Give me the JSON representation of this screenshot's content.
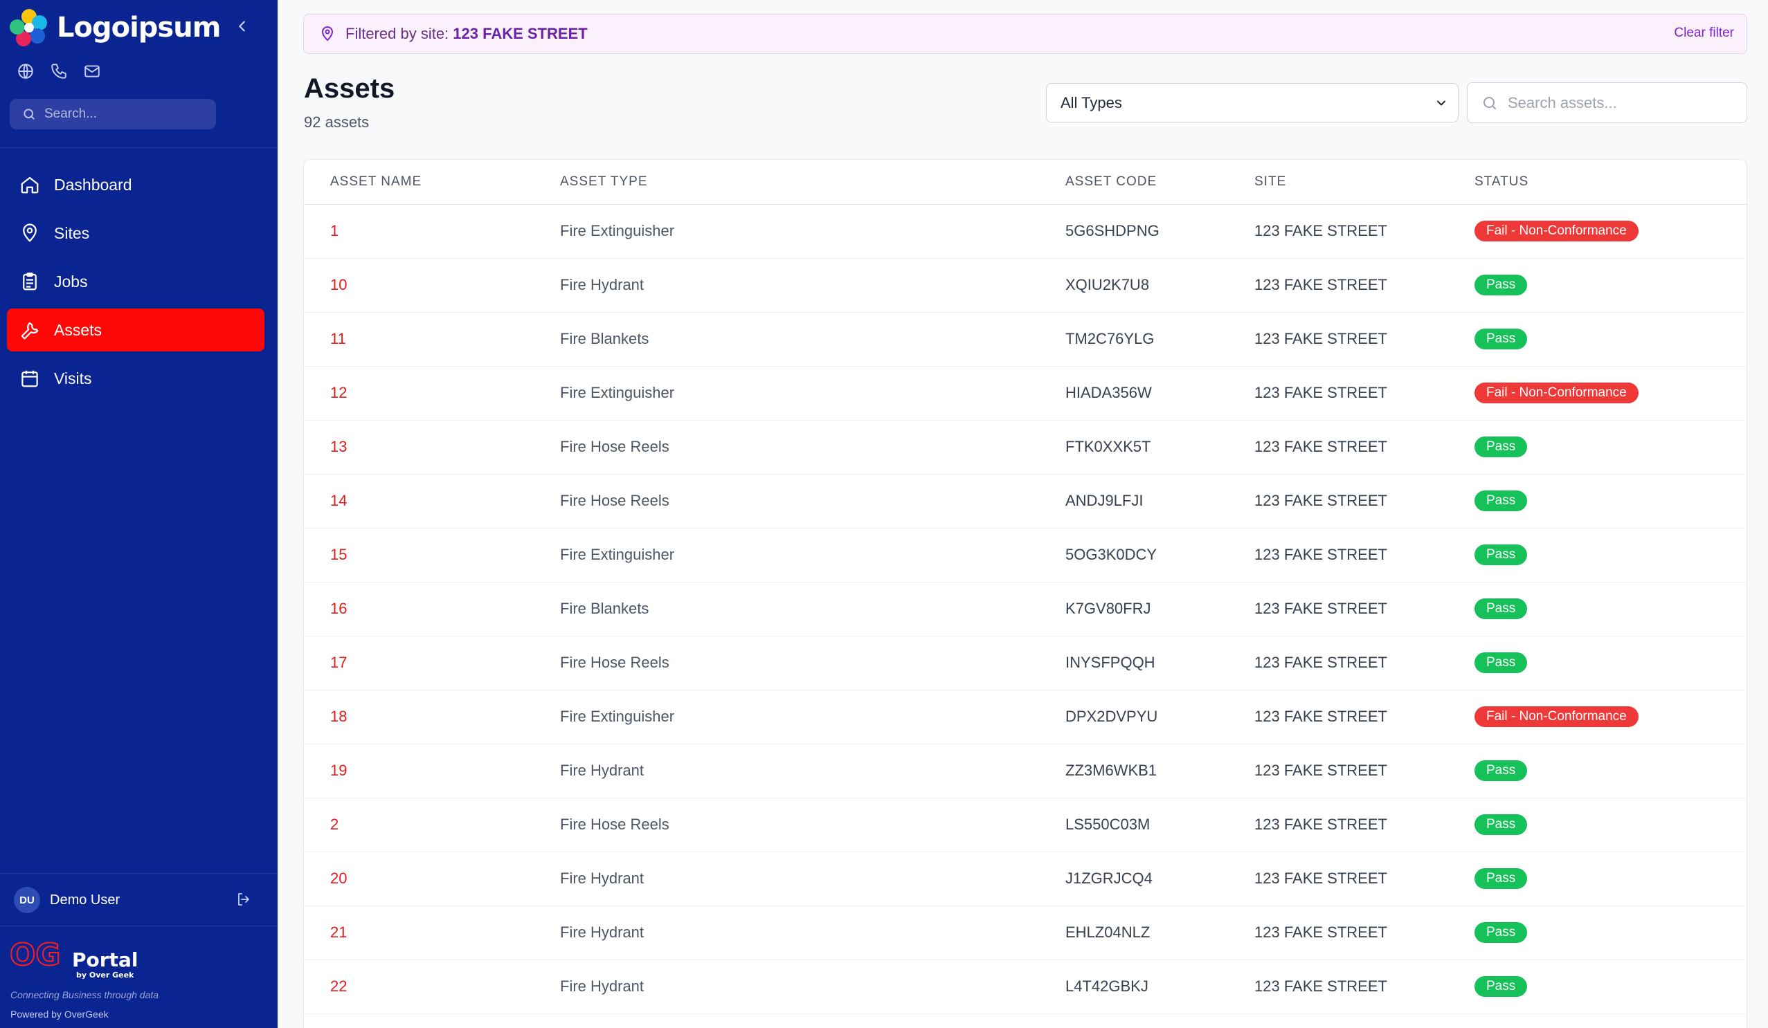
{
  "brand": {
    "name": "Logoipsum"
  },
  "sidebar": {
    "search_placeholder": "Search...",
    "nav": [
      {
        "label": "Dashboard",
        "icon": "home-icon",
        "active": false
      },
      {
        "label": "Sites",
        "icon": "map-pin-icon",
        "active": false
      },
      {
        "label": "Jobs",
        "icon": "clipboard-icon",
        "active": false
      },
      {
        "label": "Assets",
        "icon": "wrench-icon",
        "active": true
      },
      {
        "label": "Visits",
        "icon": "calendar-icon",
        "active": false
      }
    ],
    "user": {
      "initials": "DU",
      "name": "Demo User"
    },
    "footer": {
      "og_brand": "OG",
      "portal_label": "Portal",
      "by_label": "by Over Geek",
      "tagline": "Connecting Business through data",
      "powered_by": "Powered by OverGeek"
    },
    "colors": {
      "background": "#0a2492",
      "active": "#ff0707"
    }
  },
  "filter": {
    "prefix": "Filtered by site: ",
    "site": "123 FAKE STREET",
    "clear_label": "Clear filter"
  },
  "page": {
    "title": "Assets",
    "count_label": "92 assets"
  },
  "controls": {
    "type_select": {
      "selected": "All Types"
    },
    "search_placeholder": "Search assets..."
  },
  "table": {
    "columns": [
      "ASSET NAME",
      "ASSET TYPE",
      "ASSET CODE",
      "SITE",
      "STATUS"
    ],
    "rows": [
      {
        "name": "1",
        "type": "Fire Extinguisher",
        "code": "5G6SHDPNG",
        "site": "123 FAKE STREET",
        "status": "Fail - Non-Conformance"
      },
      {
        "name": "10",
        "type": "Fire Hydrant",
        "code": "XQIU2K7U8",
        "site": "123 FAKE STREET",
        "status": "Pass"
      },
      {
        "name": "11",
        "type": "Fire Blankets",
        "code": "TM2C76YLG",
        "site": "123 FAKE STREET",
        "status": "Pass"
      },
      {
        "name": "12",
        "type": "Fire Extinguisher",
        "code": "HIADA356W",
        "site": "123 FAKE STREET",
        "status": "Fail - Non-Conformance"
      },
      {
        "name": "13",
        "type": "Fire Hose Reels",
        "code": "FTK0XXK5T",
        "site": "123 FAKE STREET",
        "status": "Pass"
      },
      {
        "name": "14",
        "type": "Fire Hose Reels",
        "code": "ANDJ9LFJI",
        "site": "123 FAKE STREET",
        "status": "Pass"
      },
      {
        "name": "15",
        "type": "Fire Extinguisher",
        "code": "5OG3K0DCY",
        "site": "123 FAKE STREET",
        "status": "Pass"
      },
      {
        "name": "16",
        "type": "Fire Blankets",
        "code": "K7GV80FRJ",
        "site": "123 FAKE STREET",
        "status": "Pass"
      },
      {
        "name": "17",
        "type": "Fire Hose Reels",
        "code": "INYSFPQQH",
        "site": "123 FAKE STREET",
        "status": "Pass"
      },
      {
        "name": "18",
        "type": "Fire Extinguisher",
        "code": "DPX2DVPYU",
        "site": "123 FAKE STREET",
        "status": "Fail - Non-Conformance"
      },
      {
        "name": "19",
        "type": "Fire Hydrant",
        "code": "ZZ3M6WKB1",
        "site": "123 FAKE STREET",
        "status": "Pass"
      },
      {
        "name": "2",
        "type": "Fire Hose Reels",
        "code": "LS550C03M",
        "site": "123 FAKE STREET",
        "status": "Pass"
      },
      {
        "name": "20",
        "type": "Fire Hydrant",
        "code": "J1ZGRJCQ4",
        "site": "123 FAKE STREET",
        "status": "Pass"
      },
      {
        "name": "21",
        "type": "Fire Hydrant",
        "code": "EHLZ04NLZ",
        "site": "123 FAKE STREET",
        "status": "Pass"
      },
      {
        "name": "22",
        "type": "Fire Hydrant",
        "code": "L4T42GBKJ",
        "site": "123 FAKE STREET",
        "status": "Pass"
      }
    ]
  },
  "status_colors": {
    "Pass": "#16c15a",
    "Fail - Non-Conformance": "#ef3838"
  }
}
